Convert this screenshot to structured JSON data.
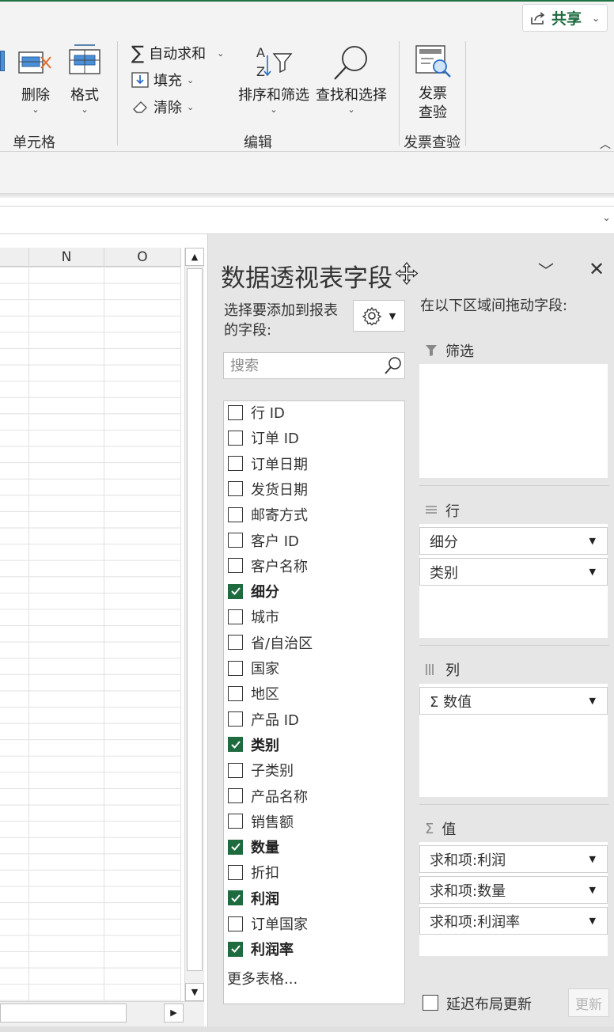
{
  "ribbon": {
    "share_label": "共享",
    "cells_group": {
      "label": "单元格",
      "delete_label": "删除",
      "format_label": "格式"
    },
    "editing_group": {
      "label": "编辑",
      "autosum_label": "自动求和",
      "fill_label": "填充",
      "clear_label": "清除",
      "sort_filter_label": "排序和筛选",
      "find_select_label": "查找和选择"
    },
    "invoice_group": {
      "label": "发票查验",
      "button_line1": "发票",
      "button_line2": "查验"
    }
  },
  "grid": {
    "columns": [
      "N",
      "O"
    ]
  },
  "pivot": {
    "title": "数据透视表字段",
    "choose_fields_line1": "选择要添加到报表",
    "choose_fields_line2": "的字段:",
    "drag_hint": "在以下区域间拖动字段:",
    "search_placeholder": "搜索",
    "fields": [
      {
        "label": "行 ID",
        "checked": false
      },
      {
        "label": "订单 ID",
        "checked": false
      },
      {
        "label": "订单日期",
        "checked": false
      },
      {
        "label": "发货日期",
        "checked": false
      },
      {
        "label": "邮寄方式",
        "checked": false
      },
      {
        "label": "客户 ID",
        "checked": false
      },
      {
        "label": "客户名称",
        "checked": false
      },
      {
        "label": "细分",
        "checked": true
      },
      {
        "label": "城市",
        "checked": false
      },
      {
        "label": "省/自治区",
        "checked": false
      },
      {
        "label": "国家",
        "checked": false
      },
      {
        "label": "地区",
        "checked": false
      },
      {
        "label": "产品 ID",
        "checked": false
      },
      {
        "label": "类别",
        "checked": true
      },
      {
        "label": "子类别",
        "checked": false
      },
      {
        "label": "产品名称",
        "checked": false
      },
      {
        "label": "销售额",
        "checked": false
      },
      {
        "label": "数量",
        "checked": true
      },
      {
        "label": "折扣",
        "checked": false
      },
      {
        "label": "利润",
        "checked": true
      },
      {
        "label": "订单国家",
        "checked": false
      },
      {
        "label": "利润率",
        "checked": true
      }
    ],
    "more_tables": "更多表格...",
    "areas": {
      "filters_label": "筛选",
      "rows_label": "行",
      "rows": [
        "细分",
        "类别"
      ],
      "columns_label": "列",
      "columns": [
        "Σ 数值"
      ],
      "values_label": "值",
      "values": [
        "求和项:利润",
        "求和项:数量",
        "求和项:利润率"
      ]
    },
    "defer_label": "延迟布局更新",
    "update_label": "更新"
  }
}
